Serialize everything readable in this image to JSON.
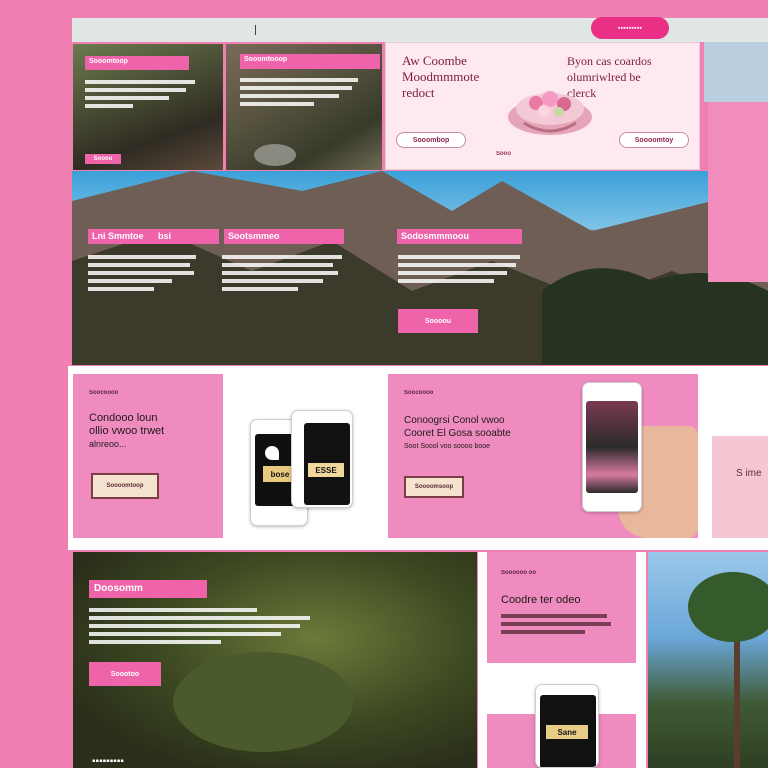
{
  "header": {
    "cta_label": "▪▪▪▪▪▪▪▪▪"
  },
  "hero_card": {
    "left_title_l1": "Aw Coombe",
    "left_title_l2": "Moodmmmote",
    "left_title_l3": "redoct",
    "right_title_l1": "Byon cas coardos",
    "right_title_l2": "olumriwlred be",
    "right_title_l3": "clerck",
    "left_button": "Sooombop",
    "right_button": "Soooomtoy",
    "caption": "Sooo"
  },
  "photo_tiles": {
    "tile1_tag": "Sooomtoop",
    "tile1_button": "Sooou",
    "tile2_tag": "Sooomtooop",
    "mountain_tag1": "Lni Smmtoe",
    "mountain_tag1b": "bsi",
    "mountain_tag2": "Sootsmmeo",
    "mountain_tag3": "Sodosmmmoou",
    "mountain_btn": "Soooou"
  },
  "promo_cards": {
    "card1_caption": "Soocoooo",
    "card1_title_l1": "Condooo loun",
    "card1_title_l2": "ollio vwoo trwet",
    "card1_title_l3": "alnreoo...",
    "card1_button": "Soooomtoop",
    "phone1_label": "bose",
    "phone2_label": "ESSE",
    "card2_caption": "Soocoooo",
    "card2_title_l1": "Conoogrsi Conol vwoo",
    "card2_title_l2": "Cooret El Gosa sooabte",
    "card2_title_l3": "Soot Soool voo soooo booe",
    "card2_button": "Soooomsoop",
    "side_text": "S ime"
  },
  "bottom": {
    "forest_tag": "Doosomm",
    "forest_button": "Soootoo",
    "card_caption": "Soooooo oo",
    "card_title": "Coodre ter odeo",
    "phone_label": "Sane",
    "footer_text": "▪▪▪▪▪▪▪▪▪"
  }
}
